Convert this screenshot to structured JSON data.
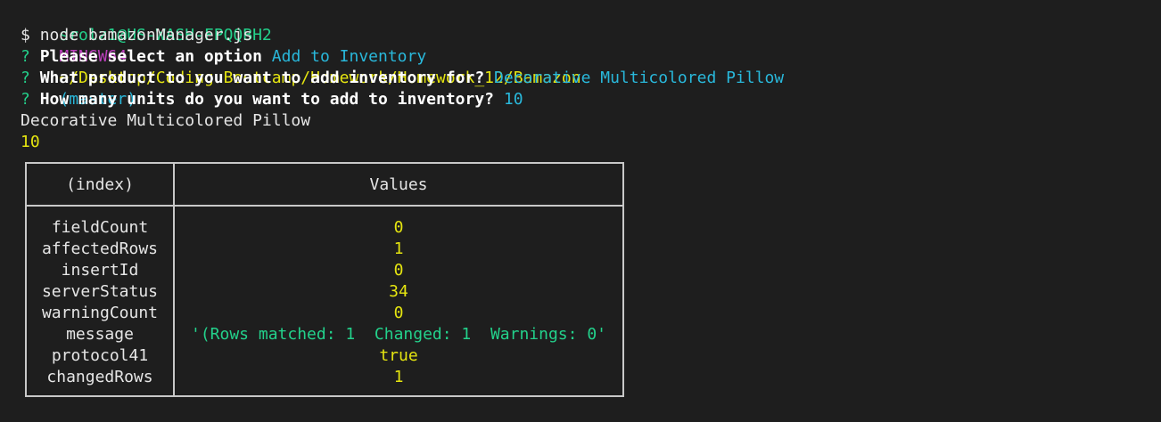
{
  "prompt": {
    "user_host": "srolz1@US-WASH-FPQQBH2",
    "shell": "MINGW64",
    "path": "~/Desktop/Coding Bootcamp/Homework/Homework_12/Bamazon",
    "branch": "(master)"
  },
  "command": {
    "symbol": "$",
    "text": "node bamazonManager.js"
  },
  "questions": [
    {
      "mark": "?",
      "question": "Please select an option",
      "answer": "Add to Inventory"
    },
    {
      "mark": "?",
      "question": "What product to you want to add inventory for?",
      "answer": "Decorative Multicolored Pillow"
    },
    {
      "mark": "?",
      "question": "How many units do you want to add to inventory?",
      "answer": "10"
    }
  ],
  "output": {
    "product_name": "Decorative Multicolored Pillow",
    "quantity": "10"
  },
  "table": {
    "headers": {
      "index": "(index)",
      "values": "Values"
    },
    "rows": [
      {
        "key": "fieldCount",
        "value": "0",
        "type": "number"
      },
      {
        "key": "affectedRows",
        "value": "1",
        "type": "number"
      },
      {
        "key": "insertId",
        "value": "0",
        "type": "number"
      },
      {
        "key": "serverStatus",
        "value": "34",
        "type": "number"
      },
      {
        "key": "warningCount",
        "value": "0",
        "type": "number"
      },
      {
        "key": "message",
        "value": "'(Rows matched: 1  Changed: 1  Warnings: 0'",
        "type": "string"
      },
      {
        "key": "protocol41",
        "value": "true",
        "type": "boolean"
      },
      {
        "key": "changedRows",
        "value": "1",
        "type": "number"
      }
    ]
  },
  "colors": {
    "background": "#1e1e1e",
    "green": "#23d18b",
    "magenta": "#bc3fbc",
    "yellow": "#e5e510",
    "cyan": "#29b8db",
    "text": "#e6e6e6"
  }
}
